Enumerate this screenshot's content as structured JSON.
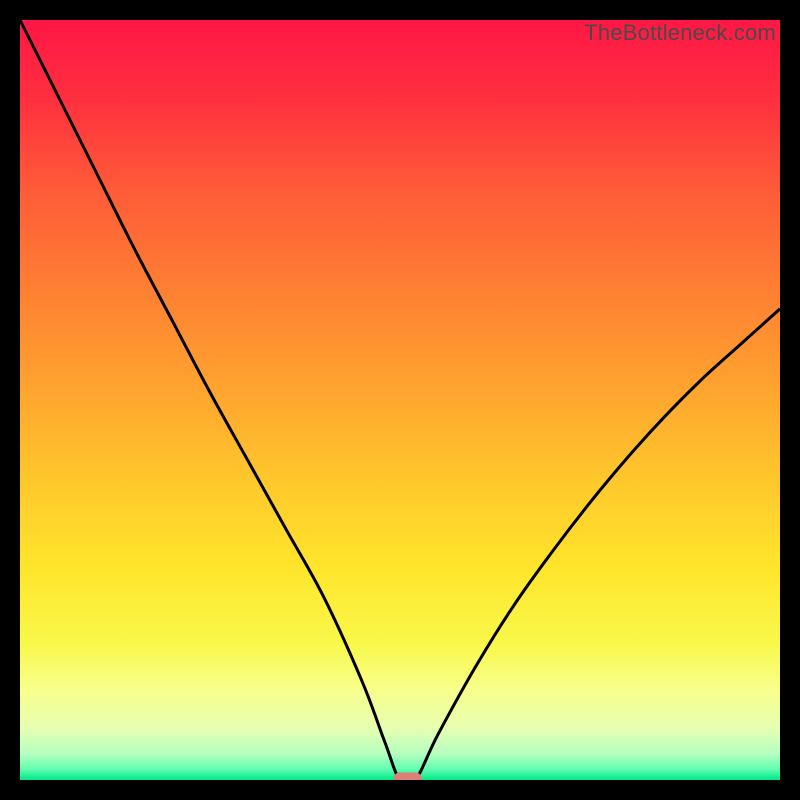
{
  "watermark": "TheBottleneck.com",
  "colors": {
    "frame": "#000000",
    "curve": "#000000",
    "marker_fill": "#dd7f74",
    "gradient_stops": [
      {
        "offset": 0.0,
        "color": "#ff1745"
      },
      {
        "offset": 0.1,
        "color": "#ff2e3f"
      },
      {
        "offset": 0.22,
        "color": "#ff5a38"
      },
      {
        "offset": 0.35,
        "color": "#ff7e33"
      },
      {
        "offset": 0.48,
        "color": "#ffa22f"
      },
      {
        "offset": 0.6,
        "color": "#ffc62c"
      },
      {
        "offset": 0.72,
        "color": "#ffe52b"
      },
      {
        "offset": 0.82,
        "color": "#f9f84a"
      },
      {
        "offset": 0.88,
        "color": "#f8ff8a"
      },
      {
        "offset": 0.93,
        "color": "#e8ffb0"
      },
      {
        "offset": 0.965,
        "color": "#b6ffc0"
      },
      {
        "offset": 0.985,
        "color": "#66ffb0"
      },
      {
        "offset": 1.0,
        "color": "#00e888"
      }
    ]
  },
  "chart_data": {
    "type": "line",
    "title": "",
    "xlabel": "",
    "ylabel": "",
    "xlim": [
      0,
      100
    ],
    "ylim": [
      0,
      100
    ],
    "x": [
      0,
      5,
      10,
      15,
      20,
      25,
      30,
      35,
      40,
      45,
      48,
      50,
      52,
      55,
      60,
      65,
      70,
      75,
      80,
      85,
      90,
      95,
      100
    ],
    "values": [
      100,
      90,
      80,
      70,
      60.5,
      51,
      42,
      33,
      24,
      13,
      5,
      0,
      0,
      6,
      15,
      23,
      30,
      36.5,
      42.5,
      48,
      53,
      57.5,
      62
    ],
    "marker": {
      "x": 51,
      "y": 0
    },
    "annotations": []
  }
}
